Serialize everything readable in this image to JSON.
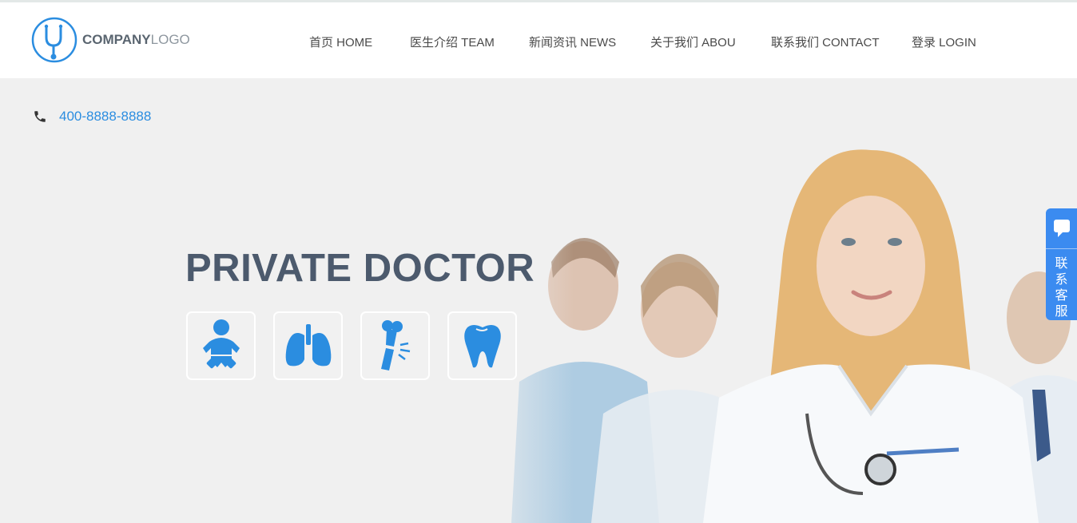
{
  "brand": {
    "logo_bold": "COMPANY",
    "logo_light": "LOGO"
  },
  "nav": {
    "items": [
      {
        "label": "首页 HOME"
      },
      {
        "label": "医生介绍 TEAM"
      },
      {
        "label": "新闻资讯 NEWS"
      },
      {
        "label": "关于我们 ABOU"
      },
      {
        "label": "联系我们 CONTACT"
      },
      {
        "label": "登录 LOGIN"
      }
    ]
  },
  "contact": {
    "phone": "400-8888-8888",
    "icon": "phone-icon"
  },
  "hero": {
    "title": "PRIVATE DOCTOR",
    "services": [
      {
        "icon": "baby-icon"
      },
      {
        "icon": "lungs-icon"
      },
      {
        "icon": "broken-bone-icon"
      },
      {
        "icon": "tooth-icon"
      }
    ]
  },
  "side_widget": {
    "label": "联系客服",
    "icon": "chat-bubble-icon"
  },
  "colors": {
    "accent": "#2b8de0",
    "title": "#4c5a6d",
    "side": "#3b8bf0",
    "hero_bg": "#f0f0f0"
  }
}
